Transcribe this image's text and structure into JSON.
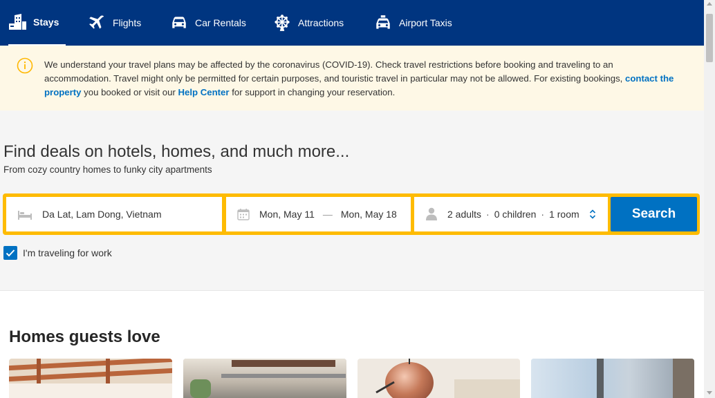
{
  "nav": {
    "tabs": [
      {
        "label": "Stays",
        "icon": "bed-building-icon",
        "active": true
      },
      {
        "label": "Flights",
        "icon": "plane-icon",
        "active": false
      },
      {
        "label": "Car Rentals",
        "icon": "car-icon",
        "active": false
      },
      {
        "label": "Attractions",
        "icon": "ferris-wheel-icon",
        "active": false
      },
      {
        "label": "Airport Taxis",
        "icon": "taxi-icon",
        "active": false
      }
    ]
  },
  "banner": {
    "icon": "info-icon",
    "text_1": "We understand your travel plans may be affected by the coronavirus (COVID-19). Check travel restrictions before booking and traveling to an accommodation. Travel might only be permitted for certain purposes, and touristic travel in particular may not be allowed. For existing bookings, ",
    "link_property": "contact the property",
    "text_2": " you booked or visit our ",
    "link_help": "Help Center",
    "text_3": " for support in changing your reservation."
  },
  "hero": {
    "title": "Find deals on hotels, homes, and much more...",
    "subtitle": "From cozy country homes to funky city apartments"
  },
  "search": {
    "destination": "Da Lat, Lam Dong, Vietnam",
    "checkin": "Mon, May 11",
    "separator": "—",
    "checkout": "Mon, May 18",
    "adults": "2 adults",
    "children": "0 children",
    "rooms": "1 room",
    "dot": "·",
    "button": "Search",
    "work_travel_label": "I'm traveling for work",
    "work_travel_checked": true
  },
  "section": {
    "title": "Homes guests love"
  },
  "colors": {
    "brand_navy": "#003580",
    "accent_blue": "#0071c2",
    "search_yellow": "#febb02",
    "banner_bg": "#fef8e6"
  }
}
